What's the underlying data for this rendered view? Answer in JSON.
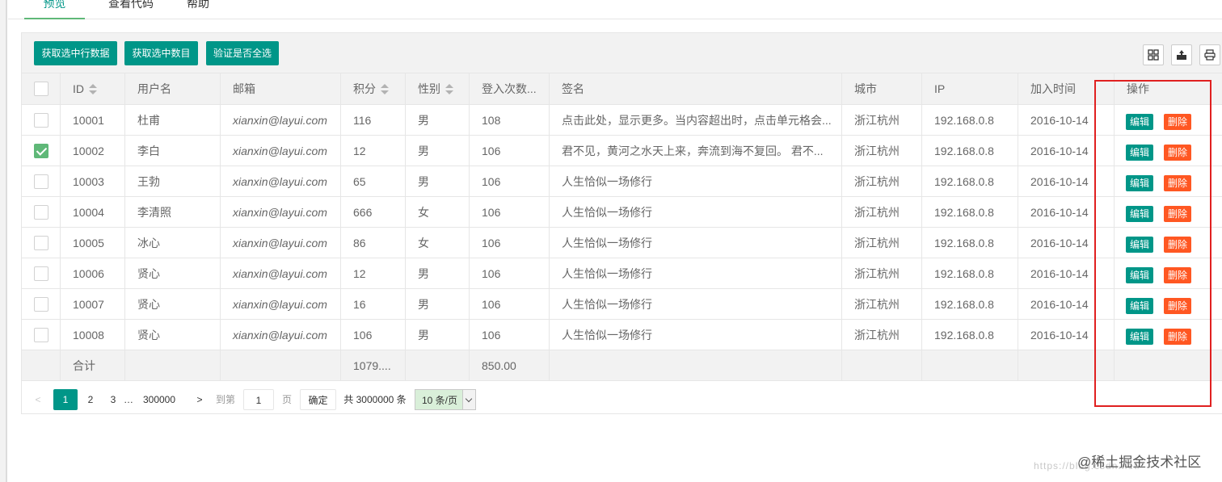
{
  "tabs": [
    {
      "label": "预览",
      "active": true
    },
    {
      "label": "查看代码",
      "active": false
    },
    {
      "label": "帮助",
      "active": false
    }
  ],
  "toolbar": {
    "buttons": [
      "获取选中行数据",
      "获取选中数目",
      "验证是否全选"
    ],
    "icons": [
      "columns-icon",
      "export-icon",
      "print-icon"
    ]
  },
  "table": {
    "columns": [
      "ID",
      "用户名",
      "邮箱",
      "积分",
      "性别",
      "登入次数...",
      "签名",
      "城市",
      "IP",
      "加入时间",
      "操作"
    ],
    "sortable": [
      "ID",
      "积分",
      "性别"
    ],
    "rows": [
      {
        "checked": false,
        "id": "10001",
        "username": "杜甫",
        "email": "xianxin@layui.com",
        "score": "116",
        "sex": "男",
        "logins": "108",
        "sign": "点击此处，显示更多。当内容超出时，点击单元格会...",
        "city": "浙江杭州",
        "ip": "192.168.0.8",
        "joined": "2016-10-14"
      },
      {
        "checked": true,
        "id": "10002",
        "username": "李白",
        "email": "xianxin@layui.com",
        "score": "12",
        "sex": "男",
        "logins": "106",
        "sign": "君不见，黄河之水天上来，奔流到海不复回。 君不...",
        "city": "浙江杭州",
        "ip": "192.168.0.8",
        "joined": "2016-10-14"
      },
      {
        "checked": false,
        "id": "10003",
        "username": "王勃",
        "email": "xianxin@layui.com",
        "score": "65",
        "sex": "男",
        "logins": "106",
        "sign": "人生恰似一场修行",
        "city": "浙江杭州",
        "ip": "192.168.0.8",
        "joined": "2016-10-14"
      },
      {
        "checked": false,
        "id": "10004",
        "username": "李清照",
        "email": "xianxin@layui.com",
        "score": "666",
        "sex": "女",
        "logins": "106",
        "sign": "人生恰似一场修行",
        "city": "浙江杭州",
        "ip": "192.168.0.8",
        "joined": "2016-10-14"
      },
      {
        "checked": false,
        "id": "10005",
        "username": "冰心",
        "email": "xianxin@layui.com",
        "score": "86",
        "sex": "女",
        "logins": "106",
        "sign": "人生恰似一场修行",
        "city": "浙江杭州",
        "ip": "192.168.0.8",
        "joined": "2016-10-14"
      },
      {
        "checked": false,
        "id": "10006",
        "username": "贤心",
        "email": "xianxin@layui.com",
        "score": "12",
        "sex": "男",
        "logins": "106",
        "sign": "人生恰似一场修行",
        "city": "浙江杭州",
        "ip": "192.168.0.8",
        "joined": "2016-10-14"
      },
      {
        "checked": false,
        "id": "10007",
        "username": "贤心",
        "email": "xianxin@layui.com",
        "score": "16",
        "sex": "男",
        "logins": "106",
        "sign": "人生恰似一场修行",
        "city": "浙江杭州",
        "ip": "192.168.0.8",
        "joined": "2016-10-14"
      },
      {
        "checked": false,
        "id": "10008",
        "username": "贤心",
        "email": "xianxin@layui.com",
        "score": "106",
        "sex": "男",
        "logins": "106",
        "sign": "人生恰似一场修行",
        "city": "浙江杭州",
        "ip": "192.168.0.8",
        "joined": "2016-10-14"
      }
    ],
    "row_actions": {
      "edit": "编辑",
      "delete": "删除"
    },
    "total": {
      "label": "合计",
      "score": "1079....",
      "logins": "850.00"
    }
  },
  "pager": {
    "prev": "<",
    "pages": [
      "1",
      "2",
      "3",
      "…",
      "300000"
    ],
    "current": "1",
    "next": ">",
    "goto_prefix": "到第",
    "goto_value": "1",
    "goto_suffix": "页",
    "confirm": "确定",
    "count": "共 3000000 条",
    "limit": "10 条/页"
  },
  "watermark": {
    "url": "https://blog.csdn.net/",
    "brand": "@稀土掘金技术社区"
  },
  "colors": {
    "primary": "#009688",
    "danger": "#FF5722",
    "check": "#5FB878",
    "highlight_box": "#e02020"
  }
}
